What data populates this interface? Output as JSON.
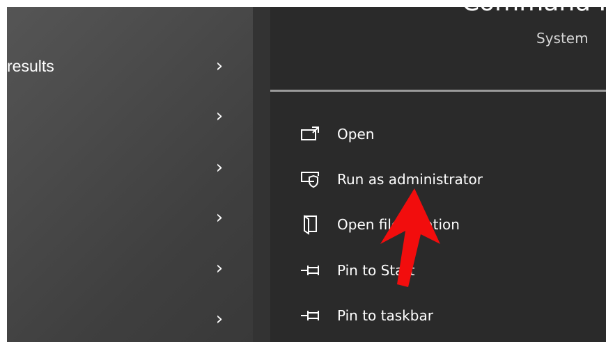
{
  "left_pane": {
    "label": "results",
    "chevron_icon": "chevron-right-icon"
  },
  "app": {
    "title": "Command Pr",
    "type": "System"
  },
  "menu": [
    {
      "label": "Open",
      "icon": "open-icon"
    },
    {
      "label": "Run as administrator",
      "icon": "run-as-admin-icon"
    },
    {
      "label": "Open file location",
      "icon": "file-location-icon"
    },
    {
      "label": "Pin to Start",
      "icon": "pin-icon"
    },
    {
      "label": "Pin to taskbar",
      "icon": "pin-icon"
    }
  ],
  "annotation": {
    "arrow_color": "#f20d0d",
    "arrow_icon": "red-arrow-up"
  }
}
